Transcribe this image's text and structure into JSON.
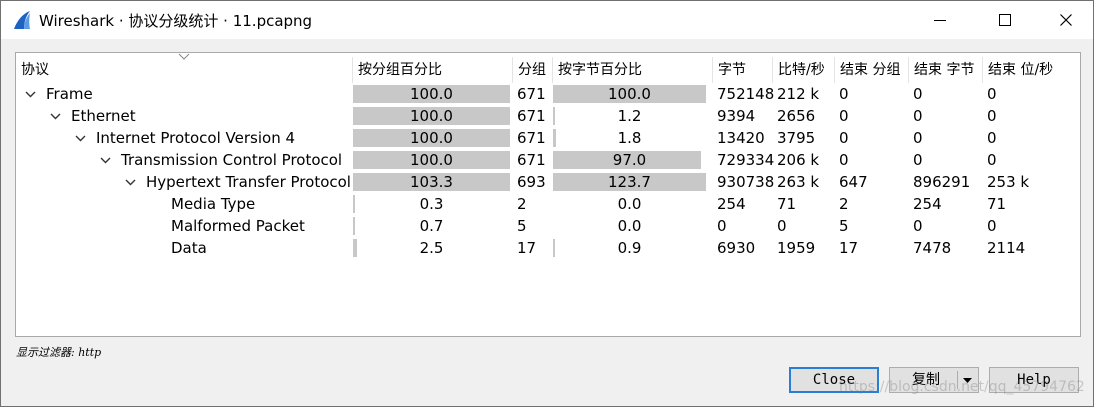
{
  "window": {
    "title": "Wireshark · 协议分级统计 · 11.pcapng",
    "icon": "wireshark-fin-icon",
    "accent": "#1e63c4"
  },
  "table": {
    "columns": [
      "协议",
      "按分组百分比",
      "分组",
      "按字节百分比",
      "字节",
      "比特/秒",
      "结束 分组",
      "结束 字节",
      "结束 位/秒"
    ],
    "rows": [
      {
        "name": "Frame",
        "level": 0,
        "expandable": true,
        "pkt_pct": "100.0",
        "pkt_pct_val": 100.0,
        "packets": "671",
        "byte_pct": "100.0",
        "byte_pct_val": 100.0,
        "bytes": "752148",
        "bps": "212 k",
        "end_pkts": "0",
        "end_bytes": "0",
        "end_bps": "0"
      },
      {
        "name": "Ethernet",
        "level": 1,
        "expandable": true,
        "pkt_pct": "100.0",
        "pkt_pct_val": 100.0,
        "packets": "671",
        "byte_pct": "1.2",
        "byte_pct_val": 1.2,
        "bytes": "9394",
        "bps": "2656",
        "end_pkts": "0",
        "end_bytes": "0",
        "end_bps": "0"
      },
      {
        "name": "Internet Protocol Version 4",
        "level": 2,
        "expandable": true,
        "pkt_pct": "100.0",
        "pkt_pct_val": 100.0,
        "packets": "671",
        "byte_pct": "1.8",
        "byte_pct_val": 1.8,
        "bytes": "13420",
        "bps": "3795",
        "end_pkts": "0",
        "end_bytes": "0",
        "end_bps": "0"
      },
      {
        "name": "Transmission Control Protocol",
        "level": 3,
        "expandable": true,
        "pkt_pct": "100.0",
        "pkt_pct_val": 100.0,
        "packets": "671",
        "byte_pct": "97.0",
        "byte_pct_val": 97.0,
        "bytes": "729334",
        "bps": "206 k",
        "end_pkts": "0",
        "end_bytes": "0",
        "end_bps": "0"
      },
      {
        "name": "Hypertext Transfer Protocol",
        "level": 4,
        "expandable": true,
        "pkt_pct": "103.3",
        "pkt_pct_val": 103.3,
        "packets": "693",
        "byte_pct": "123.7",
        "byte_pct_val": 123.7,
        "bytes": "930738",
        "bps": "263 k",
        "end_pkts": "647",
        "end_bytes": "896291",
        "end_bps": "253 k"
      },
      {
        "name": "Media Type",
        "level": 5,
        "expandable": false,
        "pkt_pct": "0.3",
        "pkt_pct_val": 0.3,
        "packets": "2",
        "byte_pct": "0.0",
        "byte_pct_val": 0.0,
        "bytes": "254",
        "bps": "71",
        "end_pkts": "2",
        "end_bytes": "254",
        "end_bps": "71"
      },
      {
        "name": "Malformed Packet",
        "level": 5,
        "expandable": false,
        "pkt_pct": "0.7",
        "pkt_pct_val": 0.7,
        "packets": "5",
        "byte_pct": "0.0",
        "byte_pct_val": 0.0,
        "bytes": "0",
        "bps": "0",
        "end_pkts": "5",
        "end_bytes": "0",
        "end_bps": "0"
      },
      {
        "name": "Data",
        "level": 5,
        "expandable": false,
        "pkt_pct": "2.5",
        "pkt_pct_val": 2.5,
        "packets": "17",
        "byte_pct": "0.9",
        "byte_pct_val": 0.9,
        "bytes": "6930",
        "bps": "1959",
        "end_pkts": "17",
        "end_bytes": "7478",
        "end_bps": "2114"
      }
    ]
  },
  "filter": {
    "label": "显示过滤器: http"
  },
  "buttons": {
    "close": "Close",
    "copy": "复制",
    "help": "Help"
  },
  "watermark": "https://blog.csdn.net/qq_45794762"
}
